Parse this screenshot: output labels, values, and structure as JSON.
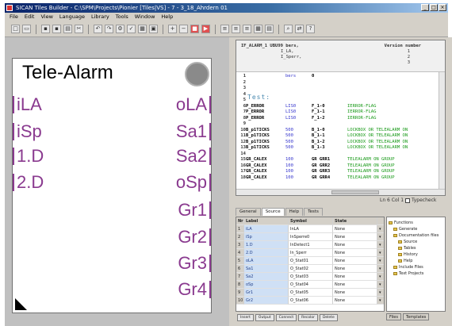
{
  "window": {
    "title": "SICAN Tiles Builder - C:\\SPM\\Projects\\Pionier [Tiles|VS] - 7 - 3_18_Ahrdern 01"
  },
  "menu": [
    "File",
    "Edit",
    "View",
    "Language",
    "Library",
    "Tools",
    "Window",
    "Help"
  ],
  "panel": {
    "title": "Tele-Alarm",
    "inputs": [
      "iLA",
      "iSp",
      "1.D",
      "2.D"
    ],
    "outputs": [
      "oLA",
      "Sa1",
      "Sa2",
      "oSp",
      "Gr1",
      "Gr2",
      "Gr3",
      "Gr4"
    ]
  },
  "editor": {
    "header_line1": "IF_ALARM_1 UBU99 bers,",
    "header_line2": "I_LA,",
    "header_line3": "I_Sperr,",
    "version_label": "Version number",
    "version_values": [
      "1",
      "2",
      "3"
    ],
    "lines": [
      {
        "n": "1",
        "kw": "",
        "a": "bers",
        "b": "0",
        "c": ""
      },
      {
        "n": "2",
        "kw": "",
        "a": "",
        "b": "",
        "c": ""
      },
      {
        "n": "3",
        "kw": "",
        "a": "",
        "b": "",
        "c": ""
      },
      {
        "n": "4",
        "kw": "",
        "a": "",
        "b": "",
        "c": ""
      },
      {
        "n": "5",
        "kw": "",
        "a": "",
        "b": "",
        "c": ""
      },
      {
        "n": "6",
        "kw": "P_ERROR",
        "a": "LIS0",
        "b": "F_1-0",
        "c": "IERROR-FLAG"
      },
      {
        "n": "7",
        "kw": "P_ERROR",
        "a": "LIS0",
        "b": "F_1-1",
        "c": "IERROR-FLAG"
      },
      {
        "n": "8",
        "kw": "P_ERROR",
        "a": "LIS0",
        "b": "F_1-2",
        "c": "IERROR-FLAG"
      },
      {
        "n": "9",
        "kw": "",
        "a": "",
        "b": "",
        "c": ""
      },
      {
        "n": "10",
        "kw": "B_p1TICKS",
        "a": "500",
        "b": "B_1-0",
        "c": "LOCKBOX OR TELEALARM ON"
      },
      {
        "n": "11",
        "kw": "B_p1TICKS",
        "a": "500",
        "b": "B_1-1",
        "c": "LOCKBOX OR TELEALARM ON"
      },
      {
        "n": "12",
        "kw": "B_p1TICKS",
        "a": "500",
        "b": "B_1-2",
        "c": "LOCKBOX OR TELEALARM ON"
      },
      {
        "n": "13",
        "kw": "B_p1TICKS",
        "a": "500",
        "b": "B_1-3",
        "c": "LOCKBOX OR TELEALARM ON"
      },
      {
        "n": "14",
        "kw": "",
        "a": "",
        "b": "",
        "c": ""
      },
      {
        "n": "15",
        "kw": "GR_CALEX",
        "a": "100",
        "b": "GR GRR1",
        "c": "TELEALARM ON GROUP"
      },
      {
        "n": "16",
        "kw": "GR_CALEX",
        "a": "100",
        "b": "GR GRR2",
        "c": "TELEALARM ON GROUP"
      },
      {
        "n": "17",
        "kw": "GR_CALEX",
        "a": "100",
        "b": "GR GRR3",
        "c": "TELEALARM ON GROUP"
      },
      {
        "n": "18",
        "kw": "GR_CALEX",
        "a": "100",
        "b": "GR GRR4",
        "c": "TELEALARM ON GROUP"
      }
    ],
    "label_text": "Test:",
    "status_left": "Ln 6 Col 1",
    "status_right": "Typecheck"
  },
  "tabs": [
    "General",
    "Source",
    "Help",
    "Tests"
  ],
  "grid": {
    "headers": [
      "Nr",
      "Label",
      "Symbol",
      "State"
    ],
    "rows": [
      {
        "n": "1",
        "label": "iLA",
        "symbol": "InLA",
        "state": "None"
      },
      {
        "n": "2",
        "label": "iSp",
        "symbol": "InSperre0",
        "state": "None"
      },
      {
        "n": "3",
        "label": "1.D",
        "symbol": "InDetect1",
        "state": "None"
      },
      {
        "n": "4",
        "label": "2.D",
        "symbol": "In_Sperr",
        "state": "None"
      },
      {
        "n": "5",
        "label": "oLA",
        "symbol": "O_Stat01",
        "state": "None"
      },
      {
        "n": "6",
        "label": "Sa1",
        "symbol": "O_Stat02",
        "state": "None"
      },
      {
        "n": "7",
        "label": "Sa2",
        "symbol": "O_Stat03",
        "state": "None"
      },
      {
        "n": "8",
        "label": "oSp",
        "symbol": "O_Stat04",
        "state": "None"
      },
      {
        "n": "9",
        "label": "Gr1",
        "symbol": "O_Stat05",
        "state": "None"
      },
      {
        "n": "10",
        "label": "Gr2",
        "symbol": "O_Stat06",
        "state": "None"
      }
    ],
    "bottom_buttons": [
      "Insert",
      "Output",
      "Connect",
      "Recolor",
      "Delete"
    ]
  },
  "tree": {
    "items": [
      "Functions",
      "Generate",
      "Documentation files",
      "Source",
      "Tables",
      "History",
      "Help",
      "Include Files",
      "Text Projects"
    ],
    "tabs": [
      "Files",
      "Templates"
    ]
  }
}
